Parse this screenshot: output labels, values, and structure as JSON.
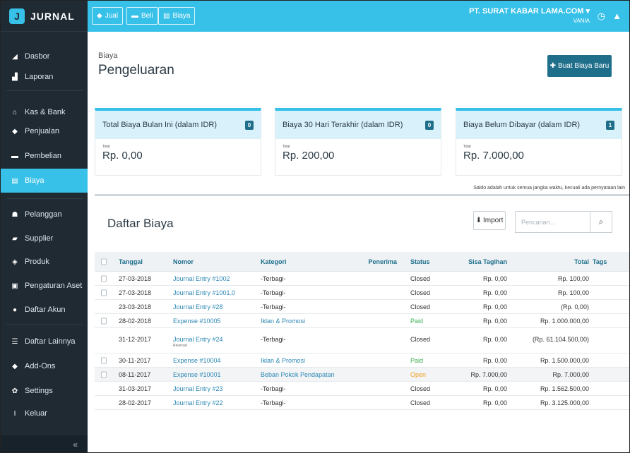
{
  "app": {
    "logo": "JURNAL"
  },
  "sidebar": {
    "items": [
      {
        "label": "Dasbor",
        "icon": "dashboard-icon",
        "glyph": "◢"
      },
      {
        "label": "Laporan",
        "icon": "report-icon",
        "glyph": "▟"
      },
      {
        "label": "Kas & Bank",
        "icon": "bank-icon",
        "glyph": "⌂"
      },
      {
        "label": "Penjualan",
        "icon": "tag-icon",
        "glyph": "◆"
      },
      {
        "label": "Pembelian",
        "icon": "card-icon",
        "glyph": "▬"
      },
      {
        "label": "Biaya",
        "icon": "receipt-icon",
        "glyph": "▤"
      },
      {
        "label": "Pelanggan",
        "icon": "users-icon",
        "glyph": "☗"
      },
      {
        "label": "Supplier",
        "icon": "truck-icon",
        "glyph": "▰"
      },
      {
        "label": "Produk",
        "icon": "box-icon",
        "glyph": "◈"
      },
      {
        "label": "Pengaturan Aset",
        "icon": "asset-icon",
        "glyph": "▣"
      },
      {
        "label": "Daftar Akun",
        "icon": "account-icon",
        "glyph": "●"
      },
      {
        "label": "Daftar Lainnya",
        "icon": "list-icon",
        "glyph": "☰"
      },
      {
        "label": "Add-Ons",
        "icon": "addons-icon",
        "glyph": "◆"
      },
      {
        "label": "Settings",
        "icon": "settings-icon",
        "glyph": "✿"
      },
      {
        "label": "Keluar",
        "icon": "logout-icon",
        "glyph": "I"
      }
    ],
    "collapse_glyph": "«"
  },
  "topbar": {
    "jual": "Jual",
    "beli": "Beli",
    "biaya": "Biaya",
    "company": "PT. SURAT KABAR LAMA.COM ▾",
    "user": "VANIA"
  },
  "page": {
    "breadcrumb": "Biaya",
    "title": "Pengeluaran",
    "new_button": "Buat Biaya Baru"
  },
  "cards": [
    {
      "title": "Total Biaya Bulan Ini (dalam IDR)",
      "badge": "0",
      "small": "Total",
      "value": "Rp. 0,00"
    },
    {
      "title": "Biaya 30 Hari Terakhir (dalam IDR)",
      "badge": "0",
      "small": "Total",
      "value": "Rp. 200,00"
    },
    {
      "title": "Biaya Belum Dibayar (dalam IDR)",
      "badge": "1",
      "small": "Total",
      "value": "Rp. 7.000,00"
    }
  ],
  "note": "Saldo adalah untuk semua jangka waktu, kecuali ada pernyataan lain",
  "list": {
    "title": "Daftar Biaya",
    "import": "Import",
    "search_placeholder": "Pencarian..."
  },
  "table": {
    "headers": [
      "Tanggal",
      "Nomor",
      "Kategori",
      "Penerima",
      "Status",
      "Sisa Tagihan",
      "Total",
      "Tags"
    ],
    "rows": [
      {
        "tanggal": "27-03-2018",
        "nomor": "Journal Entry #1002",
        "kategori": "-Terbagi-",
        "penerima": "",
        "status": "Closed",
        "sisa": "Rp. 0,00",
        "total": "Rp. 100,00"
      },
      {
        "tanggal": "27-03-2018",
        "nomor": "Journal Entry #1001.0",
        "kategori": "-Terbagi-",
        "penerima": "",
        "status": "Closed",
        "sisa": "Rp. 0,00",
        "total": "Rp. 100,00"
      },
      {
        "tanggal": "23-03-2018",
        "nomor": "Journal Entry #28",
        "kategori": "-Terbagi-",
        "penerima": "",
        "status": "Closed",
        "sisa": "Rp. 0,00",
        "total": "(Rp. 0,00)"
      },
      {
        "tanggal": "28-02-2018",
        "nomor": "Expense #10005",
        "kategori": "Iklan & Promosi",
        "penerima": "",
        "status": "Paid",
        "sisa": "Rp. 0,00",
        "total": "Rp. 1.000.000,00"
      },
      {
        "tanggal": "31-12-2017",
        "nomor": "Journal Entry #24",
        "sub": "Reversal",
        "kategori": "-Terbagi-",
        "penerima": "",
        "status": "Closed",
        "sisa": "Rp. 0,00",
        "total": "(Rp. 61.104.500,00)"
      },
      {
        "tanggal": "30-11-2017",
        "nomor": "Expense #10004",
        "kategori": "Iklan & Promosi",
        "penerima": "",
        "status": "Paid",
        "sisa": "Rp. 0,00",
        "total": "Rp. 1.500.000,00"
      },
      {
        "tanggal": "08-11-2017",
        "nomor": "Expense #10001",
        "kategori": "Beban Pokok Pendapatan",
        "penerima": "",
        "status": "Open",
        "sisa": "Rp. 7.000,00",
        "total": "Rp. 7.000,00"
      },
      {
        "tanggal": "31-03-2017",
        "nomor": "Journal Entry #23",
        "kategori": "-Terbagi-",
        "penerima": "",
        "status": "Closed",
        "sisa": "Rp. 0,00",
        "total": "Rp. 1.562.500,00"
      },
      {
        "tanggal": "28-02-2017",
        "nomor": "Journal Entry #22",
        "kategori": "-Terbagi-",
        "penerima": "",
        "status": "Closed",
        "sisa": "Rp. 0,00",
        "total": "Rp. 3.125.000,00"
      }
    ]
  },
  "colors": {
    "accent": "#37c1e8",
    "dark": "#1f2a33",
    "primary_button": "#1f6f8b",
    "link": "#2d88b5",
    "paid": "#45b05a",
    "open": "#f0a020"
  }
}
